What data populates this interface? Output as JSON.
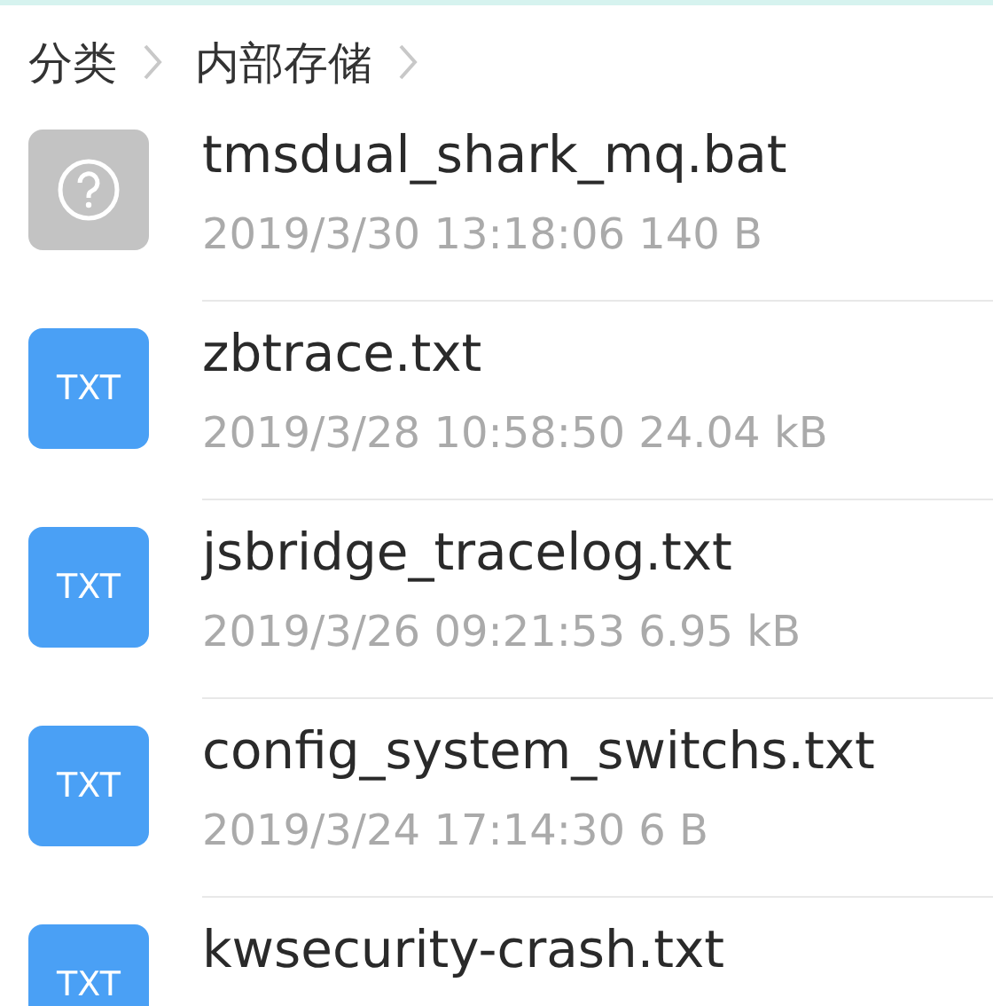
{
  "breadcrumb": [
    {
      "label": "分类"
    },
    {
      "label": "内部存储"
    }
  ],
  "files": [
    {
      "kind": "unknown",
      "name": "tmsdual_shark_mq.bat",
      "meta": "2019/3/30 13:18:06 140 B"
    },
    {
      "kind": "txt",
      "badge": "TXT",
      "name": "zbtrace.txt",
      "meta": "2019/3/28 10:58:50 24.04 kB"
    },
    {
      "kind": "txt",
      "badge": "TXT",
      "name": "jsbridge_tracelog.txt",
      "meta": "2019/3/26 09:21:53 6.95 kB"
    },
    {
      "kind": "txt",
      "badge": "TXT",
      "name": "config_system_switchs.txt",
      "meta": "2019/3/24 17:14:30 6 B"
    },
    {
      "kind": "txt",
      "badge": "TXT",
      "name": "kwsecurity-crash.txt"
    }
  ]
}
